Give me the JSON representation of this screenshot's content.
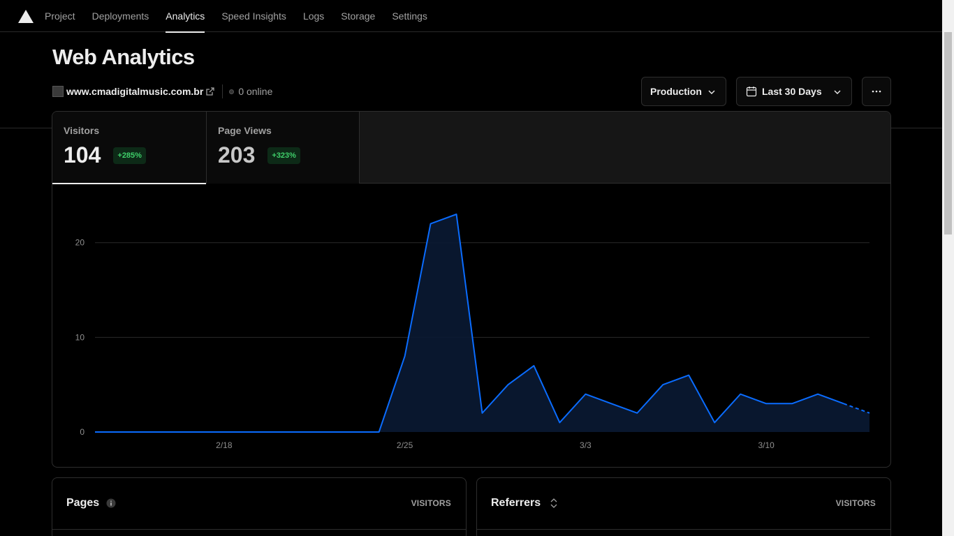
{
  "nav": {
    "tabs": [
      {
        "label": "Project"
      },
      {
        "label": "Deployments"
      },
      {
        "label": "Analytics",
        "active": true
      },
      {
        "label": "Speed Insights"
      },
      {
        "label": "Logs"
      },
      {
        "label": "Storage"
      },
      {
        "label": "Settings"
      }
    ]
  },
  "header": {
    "title": "Web Analytics",
    "site": "www.cmadigitalmusic.com.br",
    "online": "0 online",
    "environment": "Production",
    "range": "Last 30 Days"
  },
  "metrics": [
    {
      "label": "Visitors",
      "value": "104",
      "delta": "+285%"
    },
    {
      "label": "Page Views",
      "value": "203",
      "delta": "+323%"
    }
  ],
  "chart_data": {
    "type": "area",
    "x": [
      "2/13",
      "2/14",
      "2/15",
      "2/16",
      "2/17",
      "2/18",
      "2/19",
      "2/20",
      "2/21",
      "2/22",
      "2/23",
      "2/24",
      "2/25",
      "2/26",
      "2/27",
      "2/28",
      "2/29",
      "3/1",
      "3/2",
      "3/3",
      "3/4",
      "3/5",
      "3/6",
      "3/7",
      "3/8",
      "3/9",
      "3/10",
      "3/11",
      "3/12",
      "3/13",
      "3/14"
    ],
    "series": [
      {
        "values": [
          0,
          0,
          0,
          0,
          0,
          0,
          0,
          0,
          0,
          0,
          0,
          0,
          8,
          22,
          23,
          2,
          5,
          7,
          1,
          4,
          3,
          2,
          5,
          6,
          1,
          4,
          3,
          3,
          4,
          3,
          2
        ]
      }
    ],
    "dashed_from_index": 29,
    "x_ticks": [
      "2/18",
      "2/25",
      "3/3",
      "3/10"
    ],
    "y_ticks": [
      "0",
      "10",
      "20"
    ],
    "ylim": [
      0,
      23
    ],
    "grid": true,
    "color": "#0a6cff"
  },
  "panels": {
    "pages": {
      "title": "Pages",
      "column": "VISITORS"
    },
    "referrers": {
      "title": "Referrers",
      "column": "VISITORS"
    }
  }
}
